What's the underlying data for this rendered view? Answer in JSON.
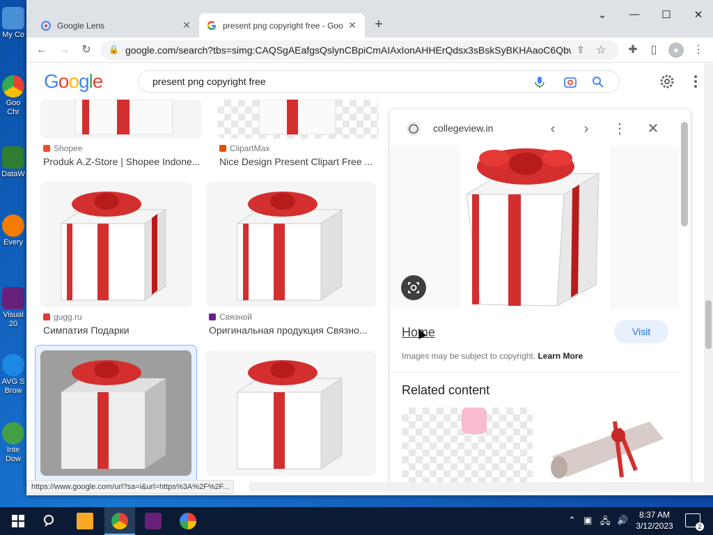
{
  "desktop": {
    "icons": [
      {
        "label": "My Co",
        "color": "#4a90d9"
      },
      {
        "label": "Goo Chr",
        "color": "#ea4335"
      },
      {
        "label": "DataW",
        "color": "#2e7d32"
      },
      {
        "label": "Every",
        "color": "#f57c00"
      },
      {
        "label": "Visual 20",
        "color": "#68217a"
      },
      {
        "label": "AVG S Brow",
        "color": "#1e88e5"
      },
      {
        "label": "Inte Dow",
        "color": "#43a047"
      }
    ]
  },
  "browser": {
    "tabs": [
      {
        "title": "Google Lens",
        "icon": "google-lens-icon",
        "active": false
      },
      {
        "title": "present png copyright free - Goo",
        "icon": "google-g-icon",
        "active": true
      }
    ],
    "new_tab_symbol": "+",
    "window_controls": {
      "dropdown": "⌄",
      "minimize": "—",
      "maximize": "☐",
      "close": "✕"
    },
    "url": "google.com/search?tbs=simg:CAQSgAEafgsQslynCBpiCmAIAxIonAHHErQdsx3sBskSyBKHAaoC6Qbw...",
    "status_url": "https://www.google.com/url?sa=i&url=https%3A%2F%2F..."
  },
  "google": {
    "logo_letters": [
      "G",
      "o",
      "o",
      "g",
      "l",
      "e"
    ],
    "logo_colors": [
      "#4285f4",
      "#ea4335",
      "#fbbc05",
      "#4285f4",
      "#34a853",
      "#ea4335"
    ],
    "query": "present png copyright free"
  },
  "results": [
    {
      "source": "Shopee",
      "source_color": "#ee4d2d",
      "title": "Produk A.Z-Store | Shopee Indone..."
    },
    {
      "source": "ClipartMax",
      "source_color": "#e65100",
      "title": "Nice Design Present Clipart Free ..."
    },
    {
      "source": "gugg.ru",
      "source_color": "#e53935",
      "title": "Симпатия Подарки"
    },
    {
      "source": "Связной",
      "source_color": "#6a1b9a",
      "title": "Оригинальная продукция Связно..."
    }
  ],
  "panel": {
    "domain": "collegeview.in",
    "home_link": "Home",
    "visit": "Visit",
    "copyright_text": "Images may be subject to copyright.",
    "learn_more": "Learn More",
    "related_heading": "Related content"
  },
  "taskbar": {
    "time": "8:37 AM",
    "date": "3/12/2023",
    "notification_count": "2"
  },
  "colors": {
    "ribbon_red": "#d32f2f",
    "accent_blue": "#1a73e8"
  }
}
